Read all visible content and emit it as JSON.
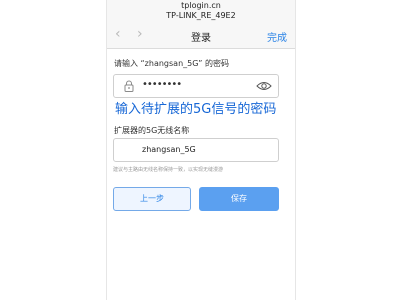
{
  "status_bar": {
    "domain": "tplogin.cn",
    "ssid": "TP-LINK_RE_49E2"
  },
  "nav": {
    "back_icon": "‹",
    "forward_icon": "›",
    "title": "登录",
    "done_label": "完成"
  },
  "form": {
    "password_prompt": "请输入 “zhangsan_5G” 的密码",
    "password_value": "••••••••",
    "overlay_text": "输入待扩展的5G信号的密码",
    "ssid_label": "扩展器的5G无线名称",
    "ssid_value": "zhangsan_5G",
    "hint": "建议与主路由无线名称保持一致，以实现无缝漫游"
  },
  "buttons": {
    "prev_label": "上一步",
    "save_label": "保存"
  },
  "colors": {
    "accent": "#2a83e6",
    "overlay_text": "#1767d6",
    "save_bg": "#5ba0f0"
  },
  "icons": {
    "lock": "lock-icon",
    "eye": "eye-icon"
  }
}
